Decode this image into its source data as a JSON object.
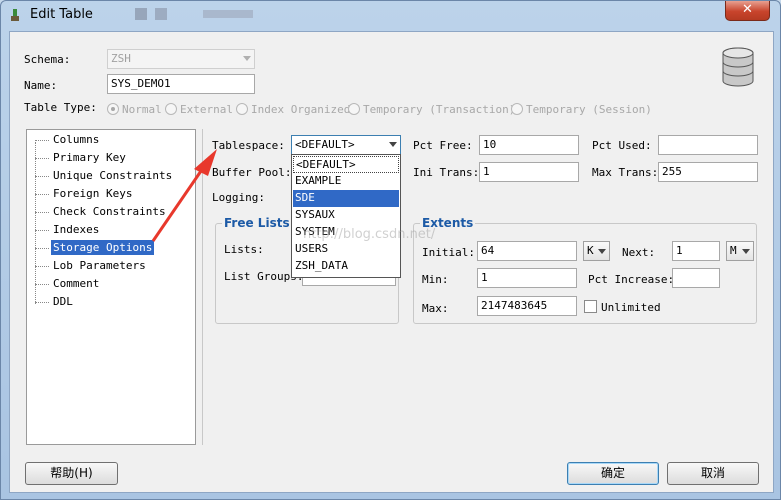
{
  "window": {
    "title": "Edit Table",
    "close_label": "✕"
  },
  "form": {
    "schema_label": "Schema:",
    "schema_value": "ZSH",
    "name_label": "Name:",
    "name_value": "SYS_DEMO1",
    "table_type_label": "Table Type:",
    "table_types": [
      "Normal",
      "External",
      "Index Organized",
      "Temporary (Transaction)",
      "Temporary (Session)"
    ],
    "selected_table_type": "Normal"
  },
  "tree": {
    "items": [
      "Columns",
      "Primary Key",
      "Unique Constraints",
      "Foreign Keys",
      "Check Constraints",
      "Indexes",
      "Storage Options",
      "Lob Parameters",
      "Comment",
      "DDL"
    ],
    "selected": "Storage Options"
  },
  "storage": {
    "tablespace_label": "Tablespace:",
    "tablespace_value": "<DEFAULT>",
    "buffer_pool_label": "Buffer Pool:",
    "logging_label": "Logging:",
    "pct_free_label": "Pct Free:",
    "pct_free_value": "10",
    "pct_used_label": "Pct Used:",
    "pct_used_value": "",
    "ini_trans_label": "Ini Trans:",
    "ini_trans_value": "1",
    "max_trans_label": "Max Trans:",
    "max_trans_value": "255"
  },
  "tablespace_options": [
    "<DEFAULT>",
    "EXAMPLE",
    "SDE",
    "SYSAUX",
    "SYSTEM",
    "USERS",
    "ZSH_DATA"
  ],
  "tablespace_highlighted": "SDE",
  "free_lists": {
    "title": "Free Lists",
    "lists_label": "Lists:",
    "list_groups_label": "List Groups:",
    "list_groups_value": ""
  },
  "extents": {
    "title": "Extents",
    "initial_label": "Initial:",
    "initial_value": "64",
    "initial_unit": "K",
    "next_label": "Next:",
    "next_value": "1",
    "next_unit": "M",
    "min_label": "Min:",
    "min_value": "1",
    "pct_increase_label": "Pct Increase:",
    "pct_increase_value": "",
    "max_label": "Max:",
    "max_value": "2147483645",
    "unlimited_label": "Unlimited"
  },
  "buttons": {
    "help": "帮助(H)",
    "ok": "确定",
    "cancel": "取消"
  },
  "watermark": "http://blog.csdn.net/",
  "colors": {
    "selection": "#3069c6",
    "group_title": "#1c5aa6",
    "annotation_arrow": "#e8382c"
  },
  "icons": {
    "title": "app-icon",
    "database": "database-icon"
  }
}
